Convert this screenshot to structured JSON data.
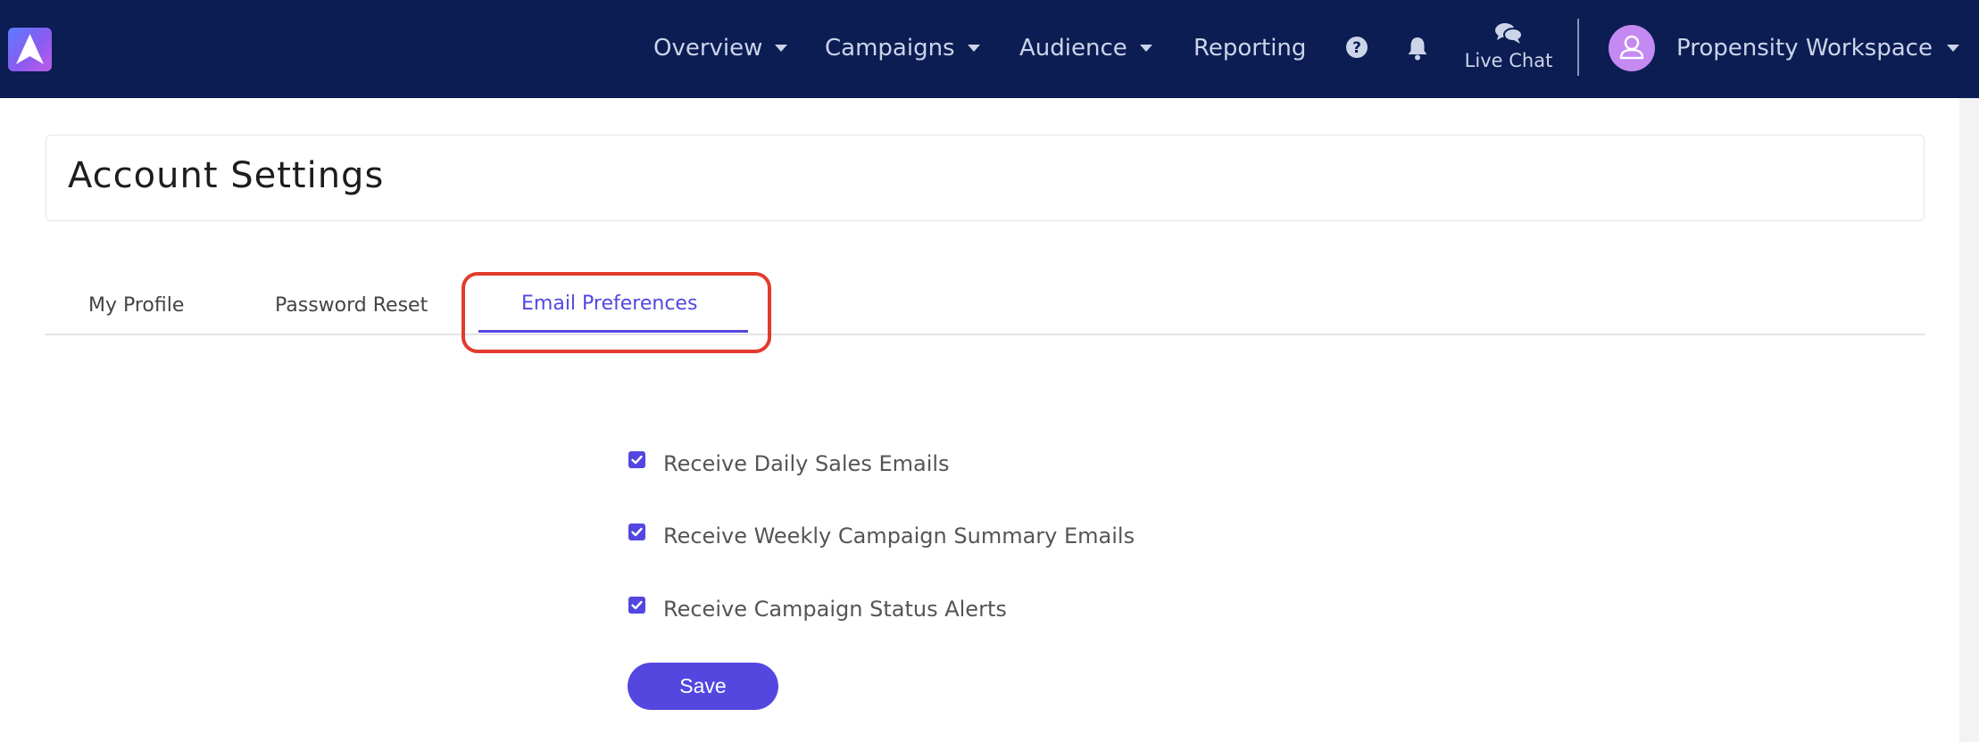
{
  "nav": {
    "items": [
      {
        "label": "Overview",
        "has_dropdown": true
      },
      {
        "label": "Campaigns",
        "has_dropdown": true
      },
      {
        "label": "Audience",
        "has_dropdown": true
      },
      {
        "label": "Reporting",
        "has_dropdown": false
      }
    ],
    "help_icon": "question-circle-icon",
    "notifications_icon": "bell-icon",
    "live_chat": {
      "label": "Live Chat",
      "icon": "chat-bubbles-icon"
    },
    "user": {
      "avatar_icon": "user-icon",
      "workspace_label": "Propensity Workspace"
    }
  },
  "page": {
    "title": "Account Settings"
  },
  "tabs": [
    {
      "label": "My Profile",
      "active": false
    },
    {
      "label": "Password Reset",
      "active": false
    },
    {
      "label": "Email Preferences",
      "active": true
    }
  ],
  "preferences": [
    {
      "label": "Receive Daily Sales Emails",
      "checked": true
    },
    {
      "label": "Receive Weekly Campaign Summary Emails",
      "checked": true
    },
    {
      "label": "Receive Campaign Status Alerts",
      "checked": true
    }
  ],
  "save_button": {
    "label": "Save"
  },
  "colors": {
    "navbar": "#0b1d52",
    "accent": "#5347e0",
    "highlight": "#e23b2d",
    "avatar": "#c589f2"
  }
}
